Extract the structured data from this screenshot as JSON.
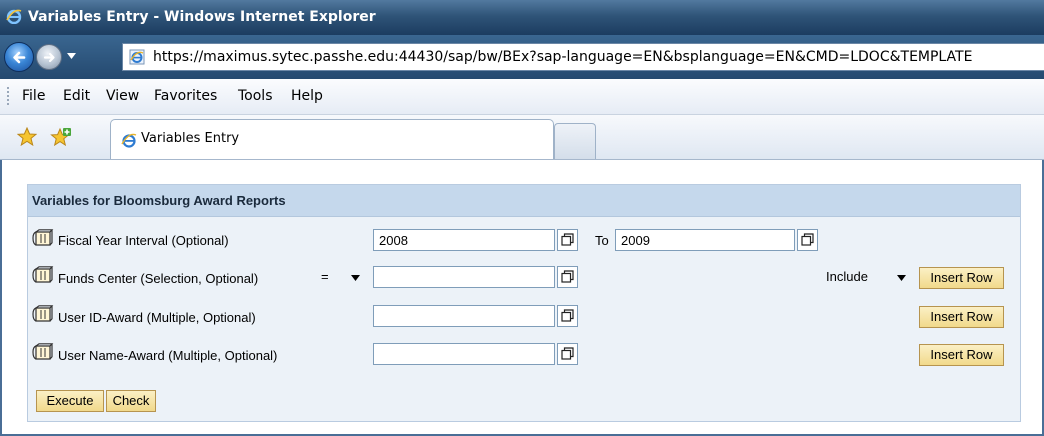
{
  "window": {
    "title": "Variables Entry - Windows Internet Explorer"
  },
  "address_bar": {
    "url": "https://maximus.sytec.passhe.edu:44430/sap/bw/BEx?sap-language=EN&bsplanguage=EN&CMD=LDOC&TEMPLATE"
  },
  "menu": {
    "items": [
      "File",
      "Edit",
      "View",
      "Favorites",
      "Tools",
      "Help"
    ]
  },
  "tabs": {
    "active_label": "Variables Entry"
  },
  "panel": {
    "title": "Variables for Bloomsburg Award Reports",
    "rows": [
      {
        "label": "Fiscal Year Interval (Optional)",
        "from_value": "2008",
        "to_label": "To",
        "to_value": "2009"
      },
      {
        "label": "Funds Center (Selection, Optional)",
        "operator": "=",
        "value": "",
        "include_option": "Include",
        "insert_label": "Insert Row"
      },
      {
        "label": "User ID-Award (Multiple, Optional)",
        "value": "",
        "insert_label": "Insert Row"
      },
      {
        "label": "User Name-Award (Multiple, Optional)",
        "value": "",
        "insert_label": "Insert Row"
      }
    ],
    "execute_label": "Execute",
    "check_label": "Check"
  },
  "colors": {
    "titlebar": "#2f5478",
    "panel_header": "#c5d8ec",
    "panel_body": "#ecf2f8",
    "button": "#f1d98b"
  },
  "icons": {
    "title": "ie-logo-icon",
    "back": "back-arrow-icon",
    "forward": "forward-arrow-icon",
    "favorites": "favorites-star-icon",
    "add_favorites": "add-favorites-icon",
    "variable": "variable-cube-icon",
    "value_help": "value-help-icon"
  }
}
